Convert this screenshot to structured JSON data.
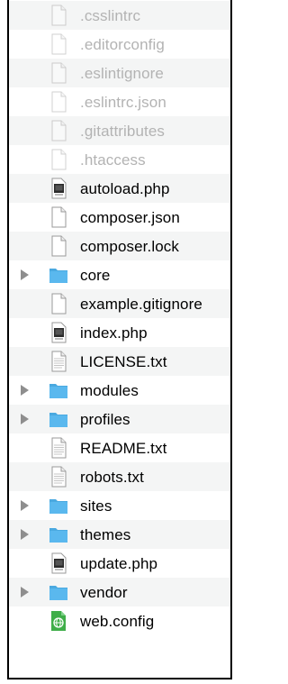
{
  "files": [
    {
      "name": ".csslintrc",
      "kind": "doc",
      "dim": true
    },
    {
      "name": ".editorconfig",
      "kind": "doc",
      "dim": true
    },
    {
      "name": ".eslintignore",
      "kind": "doc",
      "dim": true
    },
    {
      "name": ".eslintrc.json",
      "kind": "doc",
      "dim": true
    },
    {
      "name": ".gitattributes",
      "kind": "doc",
      "dim": true
    },
    {
      "name": ".htaccess",
      "kind": "doc",
      "dim": true
    },
    {
      "name": "autoload.php",
      "kind": "php",
      "dim": false
    },
    {
      "name": "composer.json",
      "kind": "doc",
      "dim": false
    },
    {
      "name": "composer.lock",
      "kind": "doc",
      "dim": false
    },
    {
      "name": "core",
      "kind": "folder",
      "dim": false
    },
    {
      "name": "example.gitignore",
      "kind": "doc",
      "dim": false
    },
    {
      "name": "index.php",
      "kind": "php",
      "dim": false
    },
    {
      "name": "LICENSE.txt",
      "kind": "txt",
      "dim": false
    },
    {
      "name": "modules",
      "kind": "folder",
      "dim": false
    },
    {
      "name": "profiles",
      "kind": "folder",
      "dim": false
    },
    {
      "name": "README.txt",
      "kind": "txt",
      "dim": false
    },
    {
      "name": "robots.txt",
      "kind": "txt",
      "dim": false
    },
    {
      "name": "sites",
      "kind": "folder",
      "dim": false
    },
    {
      "name": "themes",
      "kind": "folder",
      "dim": false
    },
    {
      "name": "update.php",
      "kind": "php",
      "dim": false
    },
    {
      "name": "vendor",
      "kind": "folder",
      "dim": false
    },
    {
      "name": "web.config",
      "kind": "config",
      "dim": false
    }
  ],
  "colors": {
    "folder": "#5ab8ee",
    "folder_tab": "#4aa9e0",
    "disclosure": "#8e8e8e",
    "dim_text": "#b3b3b3",
    "config_icon": "#3fae49"
  },
  "icons": {
    "doc": "blank-document-icon",
    "php": "php-file-icon",
    "txt": "text-document-icon",
    "folder": "folder-icon",
    "config": "config-file-icon",
    "disclosure": "disclosure-triangle-icon"
  }
}
